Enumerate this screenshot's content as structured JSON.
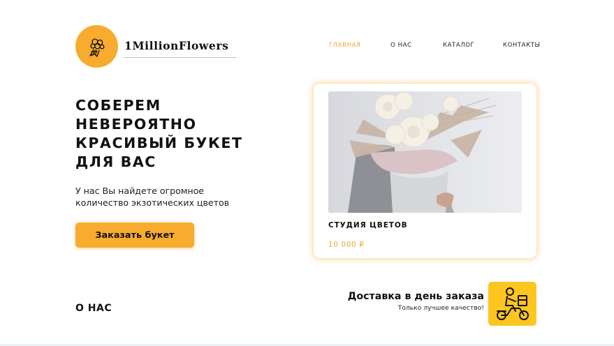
{
  "header": {
    "brand": "1MillionFlowers",
    "logo_icon": "bouquet-icon",
    "nav": [
      {
        "label": "ГЛАВНАЯ",
        "active": true
      },
      {
        "label": "О НАС",
        "active": false
      },
      {
        "label": "КАТАЛОГ",
        "active": false
      },
      {
        "label": "КОНТАКТЫ",
        "active": false
      }
    ]
  },
  "hero": {
    "title": "СОБЕРЕМ НЕВЕРОЯТНО КРАСИВЫЙ БУКЕТ ДЛЯ ВАС",
    "subtitle": "У нас Вы найдете огромное количество экзотических цветов",
    "cta_label": "Заказать букет"
  },
  "product_card": {
    "title": "СТУДИЯ ЦВЕТОВ",
    "price": "10 000 ₽",
    "image": "bouquet-photo"
  },
  "about": {
    "heading": "О НАС"
  },
  "delivery": {
    "title": "Доставка в день заказа",
    "subtitle": "Только лучшее качество!",
    "icon": "scooter-courier-icon"
  },
  "colors": {
    "accent": "#f7ab2f",
    "accent_text": "#f4a531",
    "delivery_badge": "#fcc520",
    "text": "#111111"
  }
}
